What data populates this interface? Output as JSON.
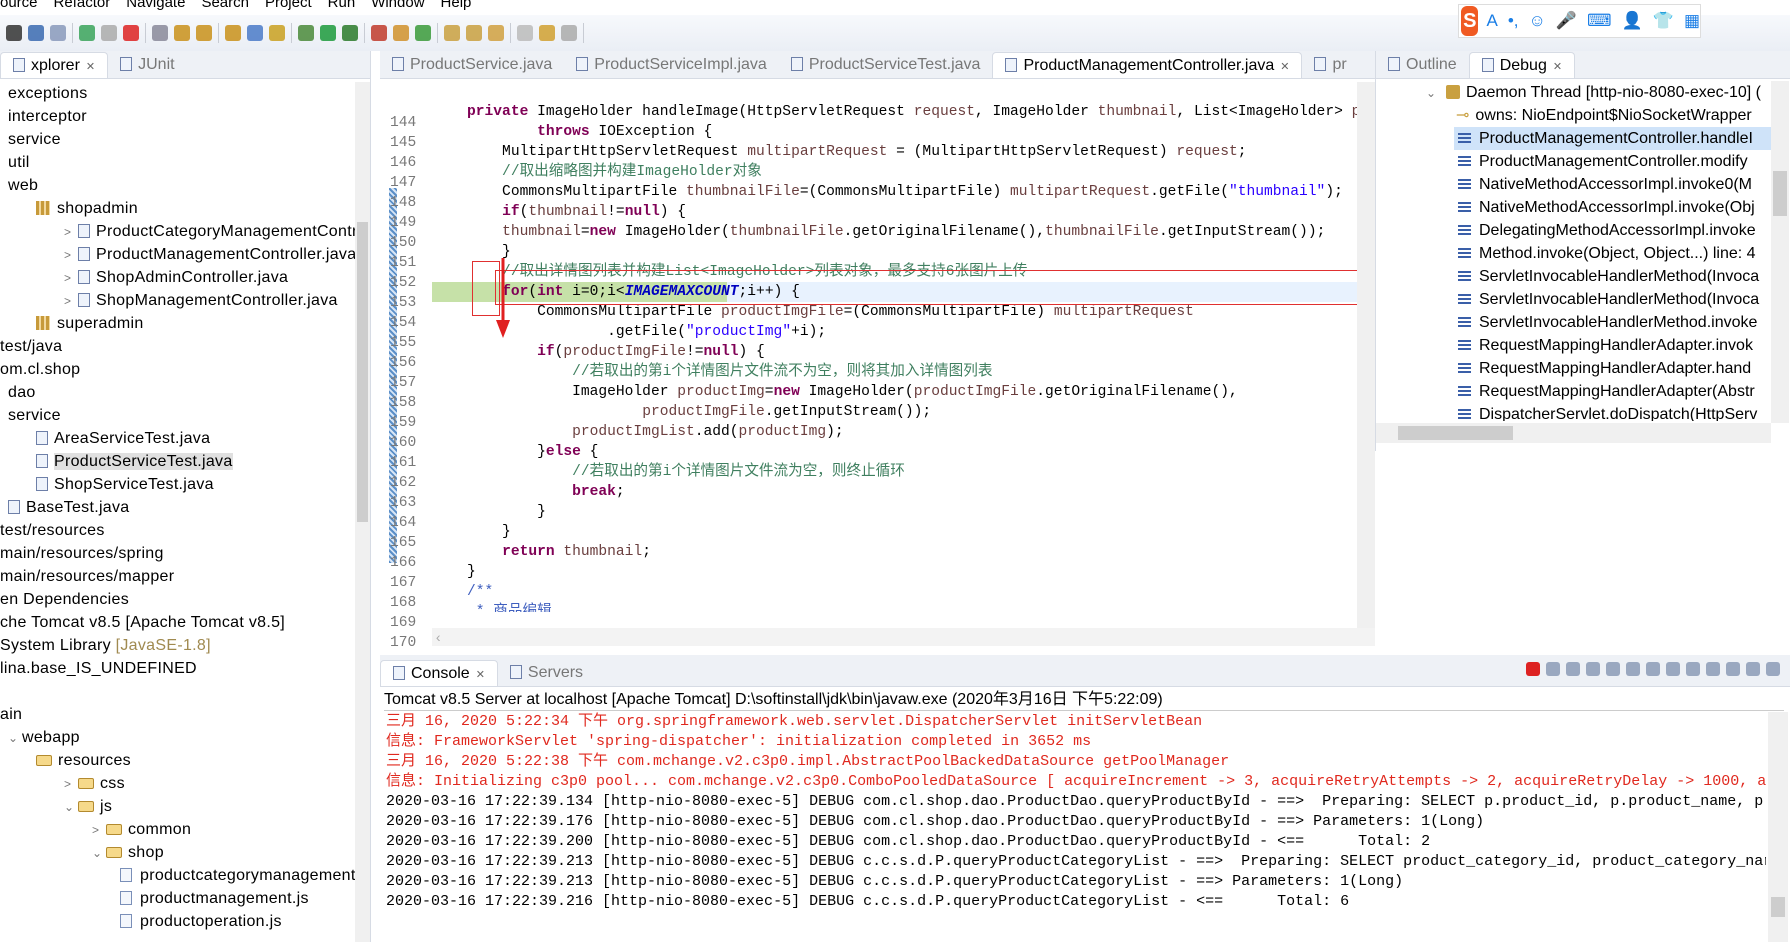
{
  "menu": [
    "ource",
    "Refactor",
    "Navigate",
    "Search",
    "Project",
    "Run",
    "Window",
    "Help"
  ],
  "toolbar_icons": [
    "debug-icon",
    "console-icon",
    "skip-breakpoints-icon",
    "resume-icon",
    "suspend-icon",
    "terminate-icon",
    "disconnect-icon",
    "step-into-icon",
    "step-over-icon",
    "step-return-icon",
    "drop-to-frame-icon",
    "use-step-filters-icon",
    "bug-icon",
    "run-icon",
    "coverage-icon",
    "external-tools-icon",
    "new-package-icon",
    "new-class-icon",
    "open-type-icon",
    "open-task-icon",
    "annotation-icon",
    "search-icon",
    "back-icon",
    "forward-icon"
  ],
  "colors": {
    "keyword": "#7f0055",
    "string": "#2a00ff",
    "comment": "#3f7f5f",
    "variable": "#6a3e3e",
    "static": "#0000c0",
    "javadoc": "#3f5fbf",
    "current_line": "#c6e1a8",
    "error_text": "#e0281e",
    "annotation_box": "#e03030",
    "selection": "#cfe3f9"
  },
  "ime": {
    "label": "S",
    "items": [
      "A",
      "•,",
      "☺",
      "🎤",
      "⌨",
      "👤",
      "👕",
      "▦"
    ]
  },
  "left_panel": {
    "tabs": [
      {
        "label": "xplorer",
        "active": true
      },
      {
        "label": "JUnit",
        "active": false
      }
    ],
    "tree": [
      {
        "label": "exceptions",
        "level": 0,
        "icon": "package"
      },
      {
        "label": "interceptor",
        "level": 0,
        "icon": "package"
      },
      {
        "label": "service",
        "level": 0,
        "icon": "package"
      },
      {
        "label": "util",
        "level": 0,
        "icon": "package"
      },
      {
        "label": "web",
        "level": 0,
        "icon": "package"
      },
      {
        "label": "shopadmin",
        "level": 1,
        "icon": "package"
      },
      {
        "label": "ProductCategoryManagementController.java",
        "level": 2,
        "icon": "java-file",
        "expander": ">"
      },
      {
        "label": "ProductManagementController.java",
        "level": 2,
        "icon": "java-file",
        "expander": ">"
      },
      {
        "label": "ShopAdminController.java",
        "level": 2,
        "icon": "java-file",
        "expander": ">"
      },
      {
        "label": "ShopManagementController.java",
        "level": 2,
        "icon": "java-file",
        "expander": ">"
      },
      {
        "label": "superadmin",
        "level": 1,
        "icon": "package"
      },
      {
        "label": "test/java",
        "level": -1,
        "icon": "none"
      },
      {
        "label": "om.cl.shop",
        "level": -1,
        "icon": "none"
      },
      {
        "label": "dao",
        "level": 0,
        "icon": "package"
      },
      {
        "label": "service",
        "level": 0,
        "icon": "package"
      },
      {
        "label": "AreaServiceTest.java",
        "level": 1,
        "icon": "java-file"
      },
      {
        "label": "ProductServiceTest.java",
        "level": 1,
        "icon": "java-file",
        "selected": true
      },
      {
        "label": "ShopServiceTest.java",
        "level": 1,
        "icon": "java-file"
      },
      {
        "label": "BaseTest.java",
        "level": 0,
        "icon": "java-file"
      },
      {
        "label": "test/resources",
        "level": -1,
        "icon": "none"
      },
      {
        "label": "main/resources/spring",
        "level": -1,
        "icon": "none"
      },
      {
        "label": "main/resources/mapper",
        "level": -1,
        "icon": "none"
      },
      {
        "label": "en Dependencies",
        "level": -1,
        "icon": "none"
      },
      {
        "label": "che Tomcat v8.5 [Apache Tomcat v8.5]",
        "level": -1,
        "icon": "none"
      },
      {
        "label": "System Library ",
        "suffix": "[JavaSE-1.8]",
        "level": -1,
        "icon": "none"
      },
      {
        "label": "lina.base_IS_UNDEFINED",
        "level": -1,
        "icon": "none"
      },
      {
        "label": "",
        "level": -1,
        "icon": "none"
      },
      {
        "label": "ain",
        "level": -1,
        "icon": "none"
      },
      {
        "label": "webapp",
        "level": 0,
        "icon": "none",
        "expander": "⌄"
      },
      {
        "label": "resources",
        "level": 1,
        "icon": "folder"
      },
      {
        "label": "css",
        "level": 2,
        "icon": "folder",
        "expander": ">"
      },
      {
        "label": "js",
        "level": 2,
        "icon": "folder",
        "expander": "⌄"
      },
      {
        "label": "common",
        "level": 3,
        "icon": "folder",
        "expander": ">"
      },
      {
        "label": "shop",
        "level": 3,
        "icon": "folder",
        "expander": "⌄"
      },
      {
        "label": "productcategorymanagement.js",
        "level": 4,
        "icon": "js-file"
      },
      {
        "label": "productmanagement.js",
        "level": 4,
        "icon": "js-file"
      },
      {
        "label": "productoperation.js",
        "level": 4,
        "icon": "js-file"
      }
    ]
  },
  "editor": {
    "tabs": [
      {
        "label": "ProductService.java",
        "active": false
      },
      {
        "label": "ProductServiceImpl.java",
        "active": false
      },
      {
        "label": "ProductServiceTest.java",
        "active": false
      },
      {
        "label": "ProductManagementController.java",
        "active": true
      },
      {
        "label": "pr",
        "active": false
      }
    ],
    "current_line": 154,
    "lines": [
      {
        "n": "144",
        "t": []
      },
      {
        "n": "145",
        "t": [
          [
            "n",
            "    "
          ],
          [
            "k",
            "private "
          ],
          [
            "n",
            "ImageHolder handleImage(HttpServletRequest "
          ],
          [
            "v",
            "request"
          ],
          [
            "n",
            ", ImageHolder "
          ],
          [
            "v",
            "thumbnail"
          ],
          [
            "n",
            ", List<ImageHolder> "
          ],
          [
            "v",
            "productImgList"
          ],
          [
            "n",
            ")"
          ]
        ]
      },
      {
        "n": "146",
        "t": [
          [
            "n",
            "            "
          ],
          [
            "k",
            "throws "
          ],
          [
            "n",
            "IOException {"
          ]
        ]
      },
      {
        "n": "147",
        "t": [
          [
            "n",
            "        MultipartHttpServletRequest "
          ],
          [
            "v",
            "multipartRequest"
          ],
          [
            "n",
            " = (MultipartHttpServletRequest) "
          ],
          [
            "v",
            "request"
          ],
          [
            "n",
            ";"
          ]
        ]
      },
      {
        "n": "148",
        "t": [
          [
            "c",
            "        //取出缩略图并构建ImageHolder对象"
          ]
        ]
      },
      {
        "n": "149",
        "t": [
          [
            "n",
            "        CommonsMultipartFile "
          ],
          [
            "v",
            "thumbnailFile"
          ],
          [
            "n",
            "=(CommonsMultipartFile) "
          ],
          [
            "v",
            "multipartRequest"
          ],
          [
            "n",
            ".getFile("
          ],
          [
            "s",
            "\"thumbnail\""
          ],
          [
            "n",
            ");"
          ]
        ]
      },
      {
        "n": "150",
        "t": [
          [
            "n",
            "        "
          ],
          [
            "k",
            "if"
          ],
          [
            "n",
            "("
          ],
          [
            "v",
            "thumbnail"
          ],
          [
            "n",
            "!="
          ],
          [
            "k",
            "null"
          ],
          [
            "n",
            ") {"
          ]
        ]
      },
      {
        "n": "151",
        "t": [
          [
            "n",
            "        "
          ],
          [
            "v",
            "thumbnail"
          ],
          [
            "n",
            "="
          ],
          [
            "k",
            "new "
          ],
          [
            "n",
            "ImageHolder("
          ],
          [
            "v",
            "thumbnailFile"
          ],
          [
            "n",
            ".getOriginalFilename(),"
          ],
          [
            "v",
            "thumbnailFile"
          ],
          [
            "n",
            ".getInputStream());"
          ]
        ]
      },
      {
        "n": "152",
        "t": [
          [
            "n",
            "        }"
          ]
        ]
      },
      {
        "n": "153",
        "t": [
          [
            "c",
            "        //取出详情图列表并构建List<ImageHolder>列表对象，最多支持6张图片上传"
          ]
        ]
      },
      {
        "n": "154",
        "t": [
          [
            "n",
            "        "
          ],
          [
            "k",
            "for"
          ],
          [
            "n",
            "("
          ],
          [
            "k",
            "int "
          ],
          [
            "n",
            "i=0;i<"
          ],
          [
            "st",
            "IMAGEMAXCOUNT"
          ],
          [
            "n",
            ";i++) {"
          ]
        ]
      },
      {
        "n": "155",
        "t": [
          [
            "n",
            "            CommonsMultipartFile "
          ],
          [
            "v",
            "productImgFile"
          ],
          [
            "n",
            "=(CommonsMultipartFile) "
          ],
          [
            "v",
            "multipartRequest"
          ]
        ]
      },
      {
        "n": "156",
        "t": [
          [
            "n",
            "                    .getFile("
          ],
          [
            "s",
            "\"productImg\""
          ],
          [
            "n",
            "+i);"
          ]
        ]
      },
      {
        "n": "157",
        "t": [
          [
            "n",
            "            "
          ],
          [
            "k",
            "if"
          ],
          [
            "n",
            "("
          ],
          [
            "v",
            "productImgFile"
          ],
          [
            "n",
            "!="
          ],
          [
            "k",
            "null"
          ],
          [
            "n",
            ") {"
          ]
        ]
      },
      {
        "n": "158",
        "t": [
          [
            "c",
            "                //若取出的第i个详情图片文件流不为空，则将其加入详情图列表"
          ]
        ]
      },
      {
        "n": "159",
        "t": [
          [
            "n",
            "                ImageHolder "
          ],
          [
            "v",
            "productImg"
          ],
          [
            "n",
            "="
          ],
          [
            "k",
            "new "
          ],
          [
            "n",
            "ImageHolder("
          ],
          [
            "v",
            "productImgFile"
          ],
          [
            "n",
            ".getOriginalFilename(),"
          ]
        ]
      },
      {
        "n": "160",
        "t": [
          [
            "n",
            "                        "
          ],
          [
            "v",
            "productImgFile"
          ],
          [
            "n",
            ".getInputStream());"
          ]
        ]
      },
      {
        "n": "161",
        "t": [
          [
            "n",
            "                "
          ],
          [
            "v",
            "productImgList"
          ],
          [
            "n",
            ".add("
          ],
          [
            "v",
            "productImg"
          ],
          [
            "n",
            ");"
          ]
        ]
      },
      {
        "n": "162",
        "t": [
          [
            "n",
            "            }"
          ],
          [
            "k",
            "else"
          ],
          [
            "n",
            " {"
          ]
        ]
      },
      {
        "n": "163",
        "t": [
          [
            "c",
            "                //若取出的第i个详情图片文件流为空，则终止循环"
          ]
        ]
      },
      {
        "n": "164",
        "t": [
          [
            "n",
            "                "
          ],
          [
            "k",
            "break"
          ],
          [
            "n",
            ";"
          ]
        ]
      },
      {
        "n": "165",
        "t": [
          [
            "n",
            "            }"
          ]
        ]
      },
      {
        "n": "166",
        "t": [
          [
            "n",
            "        }"
          ]
        ]
      },
      {
        "n": "167",
        "t": [
          [
            "n",
            "        "
          ],
          [
            "k",
            "return "
          ],
          [
            "v",
            "thumbnail"
          ],
          [
            "n",
            ";"
          ]
        ]
      },
      {
        "n": "168",
        "t": [
          [
            "n",
            "    }"
          ]
        ]
      },
      {
        "n": "169",
        "t": [
          [
            "j",
            "    /**"
          ]
        ]
      },
      {
        "n": "170",
        "t": [
          [
            "j",
            "     * 商品编辑"
          ]
        ]
      }
    ]
  },
  "debug_panel": {
    "tabs": [
      {
        "label": "Outline",
        "active": false
      },
      {
        "label": "Debug",
        "active": true
      }
    ],
    "thread": "Daemon Thread [http-nio-8080-exec-10] (",
    "owns": "owns: NioEndpoint$NioSocketWrapper",
    "frames": [
      "ProductManagementController.handleI",
      "ProductManagementController.modify",
      "NativeMethodAccessorImpl.invoke0(M",
      "NativeMethodAccessorImpl.invoke(Obj",
      "DelegatingMethodAccessorImpl.invoke",
      "Method.invoke(Object, Object...) line: 4",
      "ServletInvocableHandlerMethod(Invoca",
      "ServletInvocableHandlerMethod(Invoca",
      "ServletInvocableHandlerMethod.invoke",
      "RequestMappingHandlerAdapter.invok",
      "RequestMappingHandlerAdapter.hand",
      "RequestMappingHandlerAdapter(Abstr",
      "DispatcherServlet.doDispatch(HttpServ"
    ],
    "selected_frame": 0
  },
  "console": {
    "tabs": [
      {
        "label": "Console",
        "active": true
      },
      {
        "label": "Servers",
        "active": false
      }
    ],
    "title": "Tomcat v8.5 Server at localhost [Apache Tomcat] D:\\softinstall\\jdk\\bin\\javaw.exe (2020年3月16日 下午5:22:09)",
    "lines": [
      {
        "text": "三月 16, 2020 5:22:34 下午 org.springframework.web.servlet.DispatcherServlet initServletBean",
        "error": true
      },
      {
        "text": "信息: FrameworkServlet 'spring-dispatcher': initialization completed in 3652 ms",
        "error": true
      },
      {
        "text": "三月 16, 2020 5:22:38 下午 com.mchange.v2.c3p0.impl.AbstractPoolBackedDataSource getPoolManager",
        "error": true
      },
      {
        "text": "信息: Initializing c3p0 pool... com.mchange.v2.c3p0.ComboPooledDataSource [ acquireIncrement -> 3, acquireRetryAttempts -> 2, acquireRetryDelay -> 1000, a",
        "error": true
      },
      {
        "text": "2020-03-16 17:22:39.134 [http-nio-8080-exec-5] DEBUG com.cl.shop.dao.ProductDao.queryProductById - ==>  Preparing: SELECT p.product_id, p.product_name, p",
        "error": false
      },
      {
        "text": "2020-03-16 17:22:39.176 [http-nio-8080-exec-5] DEBUG com.cl.shop.dao.ProductDao.queryProductById - ==> Parameters: 1(Long)",
        "error": false
      },
      {
        "text": "2020-03-16 17:22:39.200 [http-nio-8080-exec-5] DEBUG com.cl.shop.dao.ProductDao.queryProductById - <==      Total: 2",
        "error": false
      },
      {
        "text": "2020-03-16 17:22:39.213 [http-nio-8080-exec-5] DEBUG c.c.s.d.P.queryProductCategoryList - ==>  Preparing: SELECT product_category_id, product_category_nar",
        "error": false
      },
      {
        "text": "2020-03-16 17:22:39.213 [http-nio-8080-exec-5] DEBUG c.c.s.d.P.queryProductCategoryList - ==> Parameters: 1(Long)",
        "error": false
      },
      {
        "text": "2020-03-16 17:22:39.216 [http-nio-8080-exec-5] DEBUG c.c.s.d.P.queryProductCategoryList - <==      Total: 6",
        "error": false
      }
    ]
  }
}
